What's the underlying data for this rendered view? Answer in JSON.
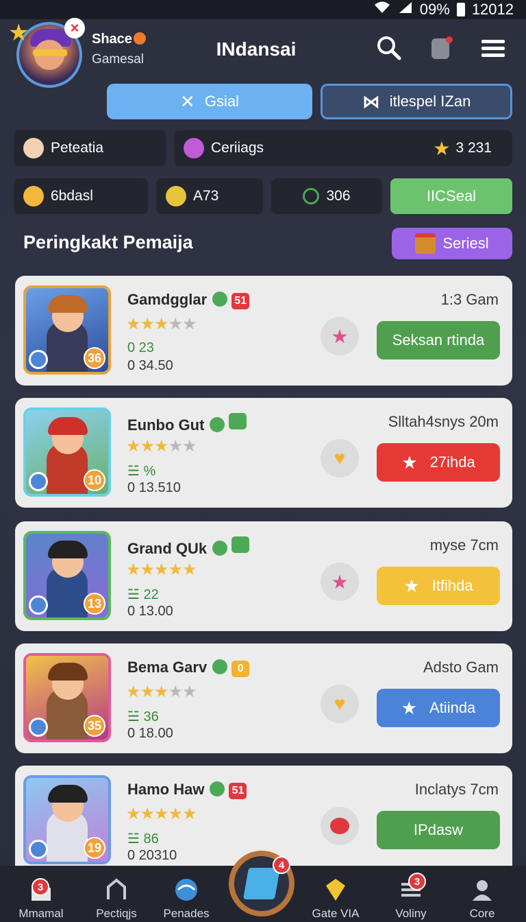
{
  "status_bar": {
    "battery": "09%",
    "time": "12012"
  },
  "header": {
    "username": "Shace",
    "subtitle": "Gamesal",
    "title": "INdansai"
  },
  "tabs": [
    {
      "label": "Gsial",
      "icon": "close-icon",
      "active": true
    },
    {
      "label": "itlespel IZan",
      "icon": "bowtie-icon",
      "active": false
    }
  ],
  "info_row": [
    {
      "label": "Peteatia",
      "icon": "avatar-icon"
    },
    {
      "label": "Ceriiags",
      "icon": "gem-icon"
    },
    {
      "label": "3 231",
      "icon": "star-icon"
    }
  ],
  "stats_row": [
    {
      "label": "6bdasl",
      "icon": "shield-icon"
    },
    {
      "label": "A73",
      "icon": "badge-icon"
    },
    {
      "label": "306",
      "icon": "recycle-icon"
    },
    {
      "label": "IICSeal",
      "icon": ""
    }
  ],
  "section": {
    "title": "Peringkakt Pemaija",
    "series_button": "Seriesl"
  },
  "cards": [
    {
      "name": "Gamdgglar",
      "tag": "51",
      "tag_color": "#e0383e",
      "stars": 3,
      "stat1": "0 23",
      "stat2": "0 34.50",
      "meta": "1:3 Gam",
      "level": "36",
      "fav": "star",
      "fav_color": "#e0508c",
      "action": "Seksan rtinda",
      "action_color": "#4f9f4f",
      "action_icon": ""
    },
    {
      "name": "Eunbo Gut",
      "tag": "",
      "tag_color": "#4caa55",
      "stars": 3,
      "stat1": "☱ %",
      "stat2": "0 13.510",
      "meta": "Slltah4snys 20m",
      "level": "10",
      "fav": "heart",
      "fav_color": "#f4b22e",
      "action": "27ihda",
      "action_color": "#e53935",
      "action_icon": "★"
    },
    {
      "name": "Grand QUk",
      "tag": "",
      "tag_color": "#4caa55",
      "stars": 5,
      "stat1": "☱ 22",
      "stat2": "0 13.00",
      "meta": "myse 7cm",
      "level": "13",
      "fav": "star",
      "fav_color": "#e0508c",
      "action": "Itfihda",
      "action_color": "#f4c13a",
      "action_icon": "★"
    },
    {
      "name": "Bema Garv",
      "tag": "0",
      "tag_color": "#f4b22e",
      "stars": 3,
      "stat1": "☱ 36",
      "stat2": "0 18.00",
      "meta": "Adsto Gam",
      "level": "35",
      "fav": "heart",
      "fav_color": "#f4b22e",
      "action": "Atiinda",
      "action_color": "#4a83d8",
      "action_icon": "★"
    },
    {
      "name": "Hamo Haw",
      "tag": "51",
      "tag_color": "#e0383e",
      "stars": 5,
      "stat1": "☱ 86",
      "stat2": "0 20310",
      "meta": "Inclatys 7cm",
      "level": "19",
      "fav": "blob",
      "fav_color": "#e0383e",
      "action": "IPdasw",
      "action_color": "#4f9f4f",
      "action_icon": ""
    }
  ],
  "navbar": [
    {
      "label": "Mmamal",
      "icon": "home-icon",
      "badge": "3"
    },
    {
      "label": "Pectiqjs",
      "icon": "house-outline-icon",
      "badge": ""
    },
    {
      "label": "Penades",
      "icon": "globe-icon",
      "badge": ""
    },
    {
      "label": "",
      "icon": "center-play-icon",
      "badge": "4"
    },
    {
      "label": "Gate VIA",
      "icon": "vip-icon",
      "badge": ""
    },
    {
      "label": "Voliny",
      "icon": "list-icon",
      "badge": "3"
    },
    {
      "label": "Core",
      "icon": "profile-icon",
      "badge": ""
    }
  ]
}
